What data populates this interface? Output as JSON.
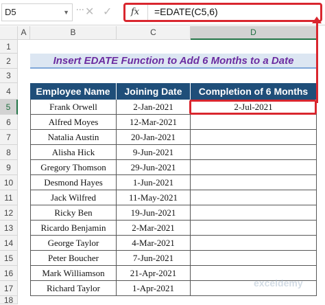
{
  "formula_bar": {
    "name_box": "D5",
    "cancel_icon": "✕",
    "enter_icon": "✓",
    "fx_label": "fx",
    "formula": "=EDATE(C5,6)"
  },
  "columns": [
    "A",
    "B",
    "C",
    "D"
  ],
  "rows": [
    "1",
    "2",
    "3",
    "4",
    "5",
    "6",
    "7",
    "8",
    "9",
    "10",
    "11",
    "12",
    "13",
    "14",
    "15",
    "16",
    "17",
    "18"
  ],
  "title": "Insert EDATE Function to Add 6 Months to a Date",
  "table": {
    "headers": [
      "Employee Name",
      "Joining Date",
      "Completion of 6 Months"
    ],
    "rows": [
      {
        "name": "Frank Orwell",
        "date": "2-Jan-2021",
        "completion": "2-Jul-2021"
      },
      {
        "name": "Alfred Moyes",
        "date": "12-Mar-2021",
        "completion": ""
      },
      {
        "name": "Natalia Austin",
        "date": "20-Jan-2021",
        "completion": ""
      },
      {
        "name": "Alisha Hick",
        "date": "9-Jun-2021",
        "completion": ""
      },
      {
        "name": "Gregory Thomson",
        "date": "29-Jun-2021",
        "completion": ""
      },
      {
        "name": "Desmond Hayes",
        "date": "1-Jun-2021",
        "completion": ""
      },
      {
        "name": "Jack Wilfred",
        "date": "11-May-2021",
        "completion": ""
      },
      {
        "name": "Ricky Ben",
        "date": "19-Jun-2021",
        "completion": ""
      },
      {
        "name": "Ricardo Benjamin",
        "date": "2-Mar-2021",
        "completion": ""
      },
      {
        "name": "George Taylor",
        "date": "4-Mar-2021",
        "completion": ""
      },
      {
        "name": "Peter Boucher",
        "date": "7-Jun-2021",
        "completion": ""
      },
      {
        "name": "Mark Williamson",
        "date": "21-Apr-2021",
        "completion": ""
      },
      {
        "name": "Richard Taylor",
        "date": "1-Apr-2021",
        "completion": ""
      }
    ]
  },
  "watermark": "exceldemy",
  "colors": {
    "header_bg": "#1f4e79",
    "title_bg": "#dce6f2",
    "title_text": "#6b2ba0",
    "highlight": "#d9262e"
  }
}
